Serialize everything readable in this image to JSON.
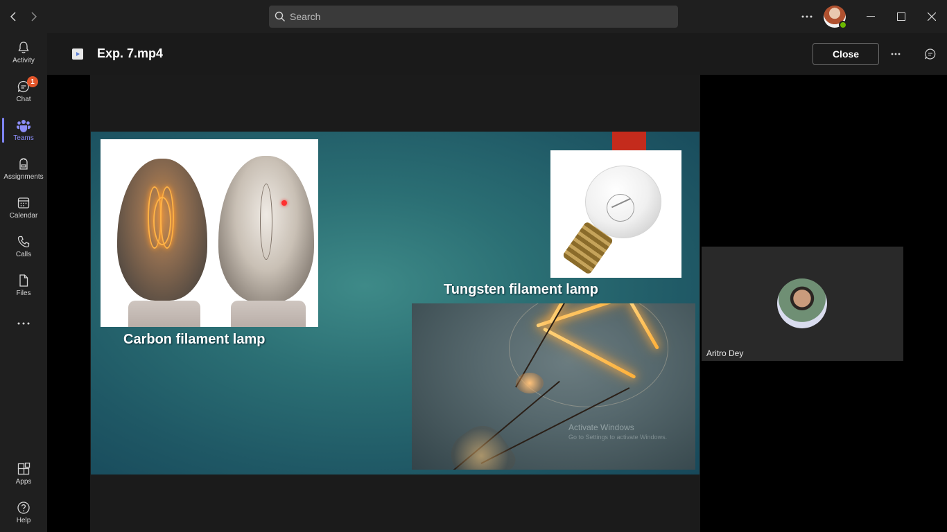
{
  "topbar": {
    "back_icon": "chevron-left-icon",
    "forward_icon": "chevron-right-icon",
    "search_placeholder": "Search",
    "more_icon": "more-horizontal-icon",
    "window_controls": [
      "minimize-icon",
      "maximize-icon",
      "close-icon"
    ],
    "presence_color": "#6bb700"
  },
  "rail": {
    "items": [
      {
        "label": "Activity",
        "icon": "bell-icon"
      },
      {
        "label": "Chat",
        "icon": "chat-icon",
        "badge": "1"
      },
      {
        "label": "Teams",
        "icon": "teams-icon",
        "active": true
      },
      {
        "label": "Assignments",
        "icon": "backpack-icon"
      },
      {
        "label": "Calendar",
        "icon": "calendar-icon"
      },
      {
        "label": "Calls",
        "icon": "phone-icon"
      },
      {
        "label": "Files",
        "icon": "file-icon"
      }
    ],
    "more_icon": "more-horizontal-icon",
    "bottom": [
      {
        "label": "Apps",
        "icon": "apps-icon"
      },
      {
        "label": "Help",
        "icon": "help-icon"
      }
    ],
    "accent_color": "#7f85f5",
    "badge_color": "#e3562b"
  },
  "header": {
    "file_icon": "video-file-icon",
    "title": "Exp. 7.mp4",
    "close_label": "Close",
    "more_icon": "more-horizontal-icon",
    "chat_icon": "conversation-icon"
  },
  "slide": {
    "carbon_label": "Carbon filament lamp",
    "tungsten_label": "Tungsten filament lamp",
    "watermark_title": "Activate Windows",
    "watermark_sub": "Go to Settings to activate Windows.",
    "accent_color": "#c42b1c"
  },
  "participant": {
    "name": "Aritro Dey"
  }
}
